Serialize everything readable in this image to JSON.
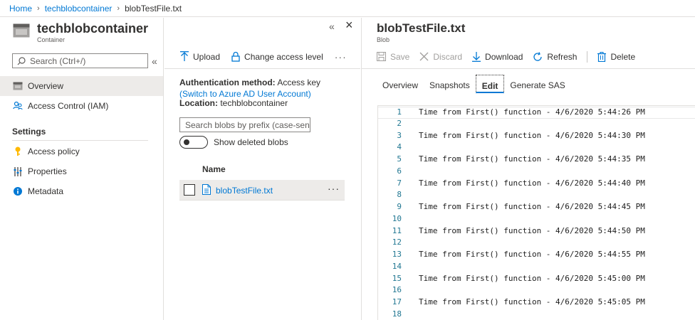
{
  "breadcrumb": {
    "home": "Home",
    "container": "techblobcontainer",
    "current": "blobTestFile.txt"
  },
  "container": {
    "title": "techblobcontainer",
    "subtitle": "Container",
    "search_placeholder": "Search (Ctrl+/)",
    "nav": [
      {
        "label": "Overview",
        "icon": "overview-icon",
        "selected": true
      },
      {
        "label": "Access Control (IAM)",
        "icon": "people-icon",
        "selected": false
      }
    ],
    "settings_heading": "Settings",
    "settings_nav": [
      {
        "label": "Access policy",
        "icon": "key-icon"
      },
      {
        "label": "Properties",
        "icon": "sliders-icon"
      },
      {
        "label": "Metadata",
        "icon": "info-icon"
      }
    ]
  },
  "blobs": {
    "toolbar": {
      "upload": "Upload",
      "change_access": "Change access level",
      "more": "···"
    },
    "auth_label": "Authentication method:",
    "auth_value": "Access key",
    "auth_link": "(Switch to Azure AD User Account)",
    "location_label": "Location:",
    "location_value": "techblobcontainer",
    "search_placeholder": "Search blobs by prefix (case-sens",
    "show_deleted_label": "Show deleted blobs",
    "show_deleted": false,
    "name_header": "Name",
    "rows": [
      {
        "name": "blobTestFile.txt",
        "more": "···"
      }
    ]
  },
  "blob": {
    "title": "blobTestFile.txt",
    "subtitle": "Blob",
    "toolbar": {
      "save": "Save",
      "discard": "Discard",
      "download": "Download",
      "refresh": "Refresh",
      "delete": "Delete"
    },
    "tabs": [
      "Overview",
      "Snapshots",
      "Edit",
      "Generate SAS"
    ],
    "active_tab": "Edit",
    "close": "×",
    "collapse": "«",
    "lines": [
      {
        "n": "1",
        "text": "Time from First() function - 4/6/2020 5:44:26 PM"
      },
      {
        "n": "2",
        "text": ""
      },
      {
        "n": "3",
        "text": "Time from First() function - 4/6/2020 5:44:30 PM"
      },
      {
        "n": "4",
        "text": ""
      },
      {
        "n": "5",
        "text": "Time from First() function - 4/6/2020 5:44:35 PM"
      },
      {
        "n": "6",
        "text": ""
      },
      {
        "n": "7",
        "text": "Time from First() function - 4/6/2020 5:44:40 PM"
      },
      {
        "n": "8",
        "text": ""
      },
      {
        "n": "9",
        "text": "Time from First() function - 4/6/2020 5:44:45 PM"
      },
      {
        "n": "10",
        "text": ""
      },
      {
        "n": "11",
        "text": "Time from First() function - 4/6/2020 5:44:50 PM"
      },
      {
        "n": "12",
        "text": ""
      },
      {
        "n": "13",
        "text": "Time from First() function - 4/6/2020 5:44:55 PM"
      },
      {
        "n": "14",
        "text": ""
      },
      {
        "n": "15",
        "text": "Time from First() function - 4/6/2020 5:45:00 PM"
      },
      {
        "n": "16",
        "text": ""
      },
      {
        "n": "17",
        "text": "Time from First() function - 4/6/2020 5:45:05 PM"
      },
      {
        "n": "18",
        "text": ""
      }
    ]
  },
  "colors": {
    "link": "#0078d4",
    "selected_bg": "#edebe9",
    "line_number": "#237893"
  }
}
